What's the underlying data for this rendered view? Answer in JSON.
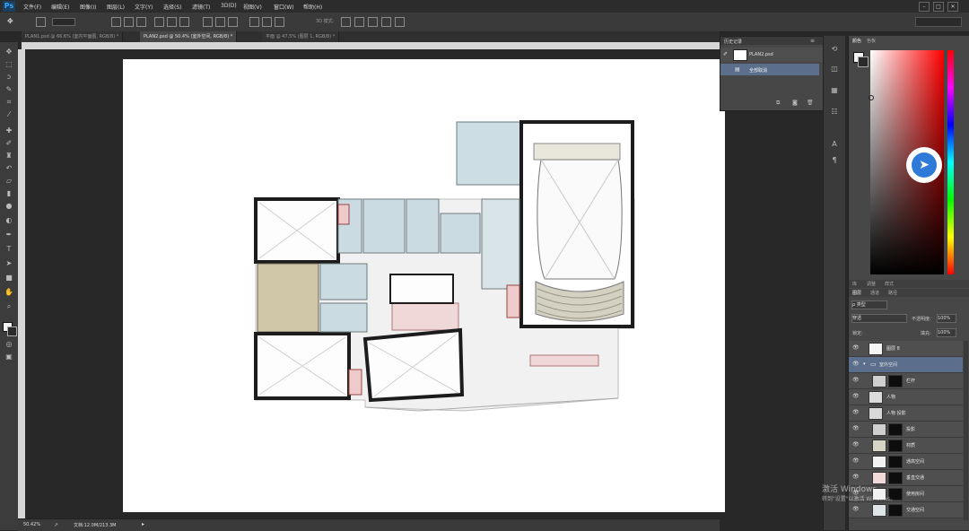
{
  "app": {
    "logo": "Ps"
  },
  "menu": [
    "文件(F)",
    "编辑(E)",
    "图像(I)",
    "图层(L)",
    "文字(Y)",
    "选择(S)",
    "滤镜(T)",
    "3D(D)",
    "视图(V)",
    "窗口(W)",
    "帮助(H)"
  ],
  "window_controls": [
    "–",
    "□",
    "✕"
  ],
  "options": {
    "mode_3d": "3D 模式:"
  },
  "tabs": [
    {
      "label": "PLAN1.psd @ 66.6% (室内平面图, RGB/8) *",
      "active": false
    },
    {
      "label": "PLAN2.psd @ 50.4% (室外空间, RGB/8) *",
      "active": true
    },
    {
      "label": "平面 @ 47.5% (图层 1, RGB/8) *",
      "active": false
    }
  ],
  "tools": [
    "move-icon",
    "marquee-icon",
    "lasso-icon",
    "quick-select-icon",
    "crop-icon",
    "eyedropper-icon",
    "healing-icon",
    "brush-icon",
    "stamp-icon",
    "history-brush-icon",
    "eraser-icon",
    "gradient-icon",
    "blur-icon",
    "dodge-icon",
    "pen-icon",
    "type-icon",
    "path-select-icon",
    "shape-icon",
    "hand-icon",
    "zoom-icon"
  ],
  "status": {
    "zoom": "50.42%",
    "doc": "文档:12.0M/213.3M"
  },
  "history": {
    "title": "历史记录",
    "snapshot": "PLAN2.psd",
    "items": [
      "全部取消"
    ]
  },
  "color_panel": {
    "tabs": [
      "颜色",
      "色板"
    ],
    "accent_fg": "#f2f2f2",
    "accent_bg": "#2a2a2a"
  },
  "adjust_tabs": [
    "库",
    "调整",
    "样式"
  ],
  "layers_panel": {
    "tabs": [
      "图层",
      "通道",
      "路径"
    ],
    "kind": "ρ 类型",
    "blend": "穿透",
    "opacity_label": "不透明度:",
    "opacity": "100%",
    "lock_label": "锁定:",
    "fill_label": "填充:",
    "fill": "100%",
    "layers": [
      {
        "name": "图层 8",
        "sel": false,
        "thumb": "#f4f4f4",
        "mask": false
      },
      {
        "name": "室外空间",
        "sel": true,
        "group": true
      },
      {
        "name": "栏杆",
        "sel": false,
        "thumb": "#cfcfcf",
        "mask": true
      },
      {
        "name": "人物",
        "sel": false,
        "thumb": "#dcdcdc",
        "mask": false
      },
      {
        "name": "人物 投影",
        "sel": false,
        "thumb": "#d8d8d8",
        "mask": false
      },
      {
        "name": "投影",
        "sel": false,
        "thumb": "#cfcfcf",
        "mask": true
      },
      {
        "name": "材质",
        "sel": false,
        "thumb": "#d7d6c5",
        "mask": true
      },
      {
        "name": "通高空间",
        "sel": false,
        "thumb": "#f2f2f2",
        "mask": true
      },
      {
        "name": "垂直交通",
        "sel": false,
        "thumb": "#f1d9d9",
        "mask": true
      },
      {
        "name": "使用房间",
        "sel": false,
        "thumb": "#f2f2f2",
        "mask": true
      },
      {
        "name": "交通空间",
        "sel": false,
        "thumb": "#dde5e8",
        "mask": true
      }
    ]
  },
  "watermark": {
    "line1": "激活 Windows",
    "line2": "转到\"设置\"以激活 Windows。"
  }
}
